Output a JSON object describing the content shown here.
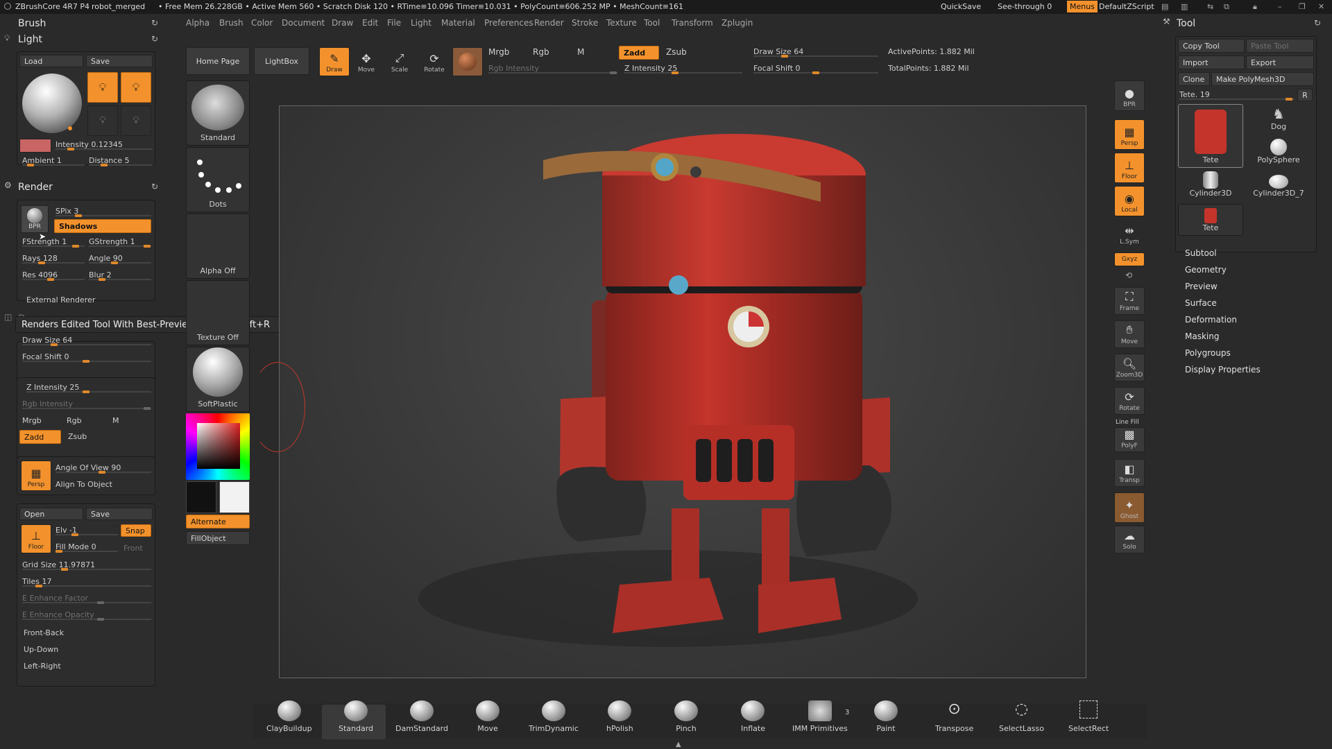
{
  "topbar": {
    "app_title": "ZBrushCore 4R7 P4",
    "document": "robot_merged",
    "status": "• Free Mem 26.228GB • Active Mem 560 • Scratch Disk 120 • RTime≡10.096 Timer≡10.031 • PolyCount≡606.252 MP • MeshCount≡161",
    "quicksave": "QuickSave",
    "see_through": "See-through",
    "see_through_value": "0",
    "menus": "Menus",
    "default_zscript": "DefaultZScript"
  },
  "menubar": [
    "Alpha",
    "Brush",
    "Color",
    "Document",
    "Draw",
    "Edit",
    "File",
    "Light",
    "Material",
    "Preferences",
    "Render",
    "Stroke",
    "Texture",
    "Tool",
    "Transform",
    "Zplugin"
  ],
  "left": {
    "brush_header": "Brush",
    "light_header": "Light",
    "light": {
      "load": "Load",
      "save": "Save",
      "intensity": "Intensity 0.12345",
      "ambient": "Ambient 1",
      "distance": "Distance 5",
      "intensity_level": 0.12,
      "ambient_level": 0.1,
      "distance_level": 0.2
    },
    "render_header": "Render",
    "render": {
      "bpr_label": "BPR",
      "spix": "SPix 3",
      "shadows": "Shadows",
      "fstrength": "FStrength 1",
      "gstrength": "GStrength 1",
      "rays": "Rays 128",
      "angle": "Angle 90",
      "res": "Res 4096",
      "blur": "Blur 2",
      "external_renderer": "External Renderer"
    },
    "tooltip": {
      "text": "Renders Edited Tool With Best-Preview Render",
      "shortcut": "Shift+R"
    },
    "draw_header": "Draw",
    "draw": {
      "draw_size": "Draw Size 64",
      "focal_shift": "Focal Shift 0",
      "z_intensity": "Z Intensity 25",
      "rgb_intensity": "Rgb Intensity",
      "mrgb": "Mrgb",
      "rgb": "Rgb",
      "m": "M",
      "zadd": "Zadd",
      "zsub": "Zsub",
      "persp": "Persp",
      "angle_of_view": "Angle Of View 90",
      "align_to_object": "Align To Object",
      "open": "Open",
      "save": "Save",
      "floor": "Floor",
      "elv": "Elv -1",
      "snap": "Snap",
      "fill_mode": "Fill Mode 0",
      "front": "Front",
      "grid_size": "Grid Size 11.97871",
      "tiles": "Tiles 17",
      "e_enhance_factor": "E Enhance Factor",
      "e_enhance_opacity": "E Enhance Opacity",
      "front_back": "Front-Back",
      "up_down": "Up-Down",
      "left_right": "Left-Right"
    }
  },
  "toolbar": {
    "home_page": "Home Page",
    "lightbox": "LightBox",
    "draw": "Draw",
    "move": "Move",
    "scale": "Scale",
    "rotate": "Rotate",
    "mrgb": "Mrgb",
    "rgb": "Rgb",
    "m": "M",
    "rgb_intensity": "Rgb Intensity",
    "zadd": "Zadd",
    "zsub": "Zsub",
    "z_intensity": "Z Intensity 25",
    "draw_size": "Draw Size 64",
    "focal_shift": "Focal Shift 0",
    "active_points": "ActivePoints: 1.882 Mil",
    "total_points": "TotalPoints: 1.882 Mil"
  },
  "palette": {
    "standard": "Standard",
    "dots": "Dots",
    "alpha_off": "Alpha Off",
    "texture_off": "Texture Off",
    "softplastic": "SoftPlastic",
    "alternate": "Alternate",
    "fillobject": "FillObject"
  },
  "right_icons": [
    "BPR",
    "Persp",
    "Floor",
    "Local",
    "L.Sym",
    "Gxyz",
    "Frame",
    "Move",
    "Zoom3D",
    "Rotate",
    "Line Fill",
    "PolyF",
    "Transp",
    "Ghost",
    "Solo"
  ],
  "tool": {
    "header": "Tool",
    "copy_tool": "Copy Tool",
    "paste_tool": "Paste Tool",
    "import": "Import",
    "export": "Export",
    "clone": "Clone",
    "make_polymesh": "Make PolyMesh3D",
    "tete_slider": "Tete. 19",
    "r": "R",
    "items": [
      "Tete",
      "Dog",
      "PolySphere",
      "Cylinder3D",
      "Cylinder3D_7",
      "Tete"
    ],
    "menu": [
      "Subtool",
      "Geometry",
      "Preview",
      "Surface",
      "Deformation",
      "Masking",
      "Polygroups",
      "Display Properties"
    ]
  },
  "shelf": [
    "ClayBuildup",
    "Standard",
    "DamStandard",
    "Move",
    "TrimDynamic",
    "hPolish",
    "Pinch",
    "Inflate",
    "IMM Primitives",
    "Paint",
    "Transpose",
    "SelectLasso",
    "SelectRect"
  ],
  "shelf_badge": "3",
  "colors": {
    "accent": "#f3922c",
    "panel": "#2d2d2d",
    "bg": "#2a2a2a",
    "robot": "#c8322a"
  }
}
